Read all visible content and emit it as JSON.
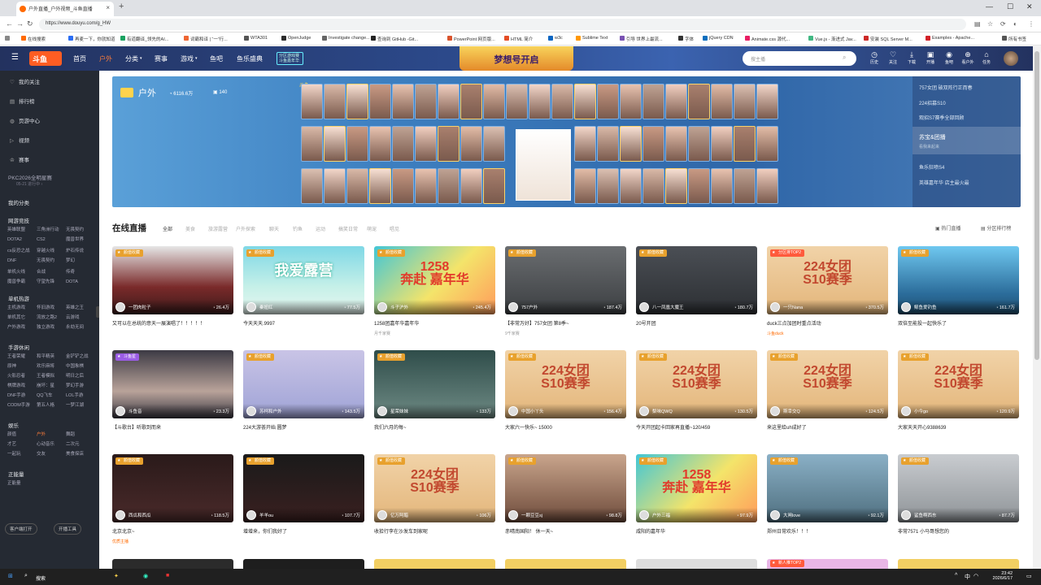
{
  "browser": {
    "tab_title": "户外直播_户外视频_斗鱼直播",
    "url": "https://www.douyu.com/g_HW",
    "new_tab": "+",
    "bookmarks": [
      "在线搜索",
      "再麦一下，你就知道",
      "有道翻译_领先的AI...",
      "词霸和译 | “一”行...",
      "WTA301",
      "OpenJudge",
      "Investigate change...",
      "查询到 GitHub -Git...",
      "PowerPoint 网页版...",
      "HTML 简介",
      "w3c",
      "Sublime Text",
      "引导 世界上最流...",
      "字体",
      "jQuery CDN",
      "Animate.css 源代...",
      "Vue.js - 渐进式 Jav...",
      "安装 SQL Server M...",
      "Examples - Apache...",
      "所有书签"
    ]
  },
  "topnav": {
    "logo": "斗鱼",
    "items": [
      "首页",
      "户外",
      "分类",
      "赛事",
      "游戏",
      "鱼吧",
      "鱼乐盛典"
    ],
    "promo": "分区游戏赛\n斗鱼嘉年华",
    "banner": "梦想号开启",
    "search_placeholder": "搜主播",
    "icons": [
      {
        "label": "历史",
        "icon": "clock-icon",
        "glyph": "◷"
      },
      {
        "label": "关注",
        "icon": "heart-icon",
        "glyph": "♡"
      },
      {
        "label": "下载",
        "icon": "download-icon",
        "glyph": "⤓"
      },
      {
        "label": "开播",
        "icon": "camera-icon",
        "glyph": "▣"
      },
      {
        "label": "鱼吧",
        "icon": "fish-icon",
        "glyph": "◉"
      },
      {
        "label": "看户外",
        "icon": "plus-icon",
        "glyph": "⊕"
      },
      {
        "label": "任务",
        "icon": "bell-icon",
        "glyph": "⌂"
      }
    ]
  },
  "sidebar": {
    "top": [
      {
        "label": "我的关注",
        "icon": "heart-icon",
        "glyph": "♡"
      },
      {
        "label": "排行榜",
        "icon": "rank-icon",
        "glyph": "▤"
      },
      {
        "label": "页游中心",
        "icon": "game-icon",
        "glyph": "◍"
      },
      {
        "label": "视频",
        "icon": "video-icon",
        "glyph": "▷"
      },
      {
        "label": "赛事",
        "icon": "trophy-icon",
        "glyph": "♔"
      }
    ],
    "event": "PKC2026全明星赛",
    "event_sub": "05-21 进行中 ›",
    "my_category": "我的分类",
    "groups": [
      {
        "title": "网游竞技",
        "items": [
          "英雄联盟",
          "三角洲行动",
          "无畏契约",
          "DOTA2",
          "CS2",
          "魔兽世界",
          "cs反恐之战",
          "穿越火线",
          "炉石传说",
          "DNF",
          "无畏契约",
          "梦幻",
          "单机火线",
          "合战",
          "传奇",
          "魔兽争霸",
          "守望先锋",
          "DOTA"
        ]
      },
      {
        "title": "单机热游",
        "items": [
          "主机游戏",
          "怀旧游戏",
          "英雄之王",
          "单机其它",
          "流放之路2",
          "云游戏",
          "户外游戏",
          "独立游戏",
          "永劫无间"
        ]
      },
      {
        "title": "手游休闲",
        "items": [
          "王者荣耀",
          "和平精英",
          "金铲铲之战",
          "原神",
          "欢乐麻将",
          "中国象棋",
          "火影忍者",
          "王者模拟",
          "明日之后",
          "棋牌游戏",
          "崩坏：星",
          "梦幻手游",
          "DNF手游",
          "QQ飞车",
          "LOL手游",
          "CODM手游",
          "第五人格",
          "一梦江湖"
        ]
      },
      {
        "title": "娱乐",
        "items": [
          "颜值",
          "户外",
          "舞蹈",
          "才艺",
          "心动音乐",
          "二次元",
          "一起玩",
          "交友",
          "美食探店"
        ]
      },
      {
        "title": "正能量",
        "items": [
          "正能量"
        ]
      }
    ],
    "btn_left": "客户端打开",
    "btn_right": "开播工具"
  },
  "hero": {
    "title": "户外",
    "count1": "6116.6万",
    "count2": "140",
    "logo": "斗鱼",
    "list": [
      "757女团 破双阵行正而春",
      "224招募S10",
      "观招S7赛季全部回顾",
      "苏宝&团播",
      "看我来起来",
      "鱼乐狂喷S4",
      "英雄嘉年华 店主最火最"
    ]
  },
  "section": {
    "title": "在线直播",
    "filters": [
      "全部",
      "美食",
      "旅游露营",
      "户外探索",
      "聊天",
      "钓鱼",
      "运动",
      "搞笑日常",
      "萌宠",
      "唱见"
    ],
    "right1": "热门直播",
    "right2": "分区排行榜"
  },
  "cards": [
    {
      "tag": "颜值收藏",
      "user": "一团肉粒子",
      "hot": "26.4万",
      "title": "又可以在总统的意天一展演唱了！！！！！",
      "sub": ""
    },
    {
      "tag": "颜值收藏",
      "user": "秦妞红",
      "hot": "77.5万",
      "title": "今天天天.9997",
      "sub": ""
    },
    {
      "tag": "颜值收藏",
      "user": "斗子沪外",
      "hot": "245.4万",
      "title": "1258团嘉年华嘉年华",
      "sub": "月千家赛"
    },
    {
      "tag": "颜值收藏",
      "user": "757户外",
      "hot": "187.4万",
      "title": "【非常万好】757女团 第8季~",
      "sub": "9千家赛"
    },
    {
      "tag": "颜值收藏",
      "user": "八一凤凰大魔王",
      "hot": "180.7万",
      "title": "20号开团",
      "sub": ""
    },
    {
      "tag": "分区排TOP2",
      "user": "一只Nana",
      "hot": "370.5万",
      "title": "duck三点加团时重点活动",
      "sub": "斗鱼duck"
    },
    {
      "tag": "颜值收藏",
      "user": "鲸鱼爱钓鱼",
      "hot": "161.7万",
      "title": "双倍至能投一起快乐了",
      "sub": ""
    },
    {
      "tag": "斗鱼星",
      "user": "斗鱼音",
      "hot": "23.3万",
      "title": "【斗歌台】听歌到而来",
      "sub": ""
    },
    {
      "tag": "颜值收藏",
      "user": "苏柯和户外",
      "hot": "143.5万",
      "title": "224大游荟开始 圆梦",
      "sub": ""
    },
    {
      "tag": "颜值收藏",
      "user": "星荣妹妹",
      "hot": "133万",
      "title": "我们六月的每~",
      "sub": ""
    },
    {
      "tag": "颜值收藏",
      "user": "中国小丫头",
      "hot": "156.4万",
      "title": "大家六一快乐~ 15000",
      "sub": ""
    },
    {
      "tag": "颜值收藏",
      "user": "梨味QWQ",
      "hot": "130.5万",
      "title": "今天开团起卡回家再直播~120/459",
      "sub": ""
    },
    {
      "tag": "颜值收藏",
      "user": "斯幸交Q",
      "hot": "124.5万",
      "title": "来这里给uh成好了",
      "sub": ""
    },
    {
      "tag": "颜值收藏",
      "user": "小今go",
      "hot": "120.9万",
      "title": "大家天天开心9388639",
      "sub": ""
    },
    {
      "tag": "颜值收藏",
      "user": "西瓜和西瓜",
      "hot": "118.5万",
      "title": "北京北京~",
      "sub": "优质主播"
    },
    {
      "tag": "颜值收藏",
      "user": "羊羊ou",
      "hot": "107.7万",
      "title": "增增来，你们我好了",
      "sub": ""
    },
    {
      "tag": "颜值收藏",
      "user": "亿万阿醋",
      "hot": "106万",
      "title": "收拾行李在沙发车到家呢",
      "sub": ""
    },
    {
      "tag": "颜值收藏",
      "user": "一颗豆豆sj",
      "hot": "98.8万",
      "title": "赤晴南国阳！ 休一天~",
      "sub": ""
    },
    {
      "tag": "颜值收藏",
      "user": "户外三福",
      "hot": "97.9万",
      "title": "咸阳的嘉年华",
      "sub": ""
    },
    {
      "tag": "颜值收藏",
      "user": "大闸love",
      "hot": "92.1万",
      "title": "郑州日常欢乐！！！",
      "sub": ""
    },
    {
      "tag": "颜值收藏",
      "user": "鲨鱼啊西东",
      "hot": "87.7万",
      "title": "非常7571 小马哥想您的",
      "sub": ""
    }
  ],
  "poster_texts": {
    "s10": "224女团\nS10赛季",
    "carn": "1258\n奔赴 嘉年华",
    "camp": "我爱露营"
  },
  "row4_tag": "新人推TOP2",
  "taskbar": {
    "search": "搜索",
    "time": "23:42",
    "date": "2026/6/17",
    "lang": "中"
  }
}
